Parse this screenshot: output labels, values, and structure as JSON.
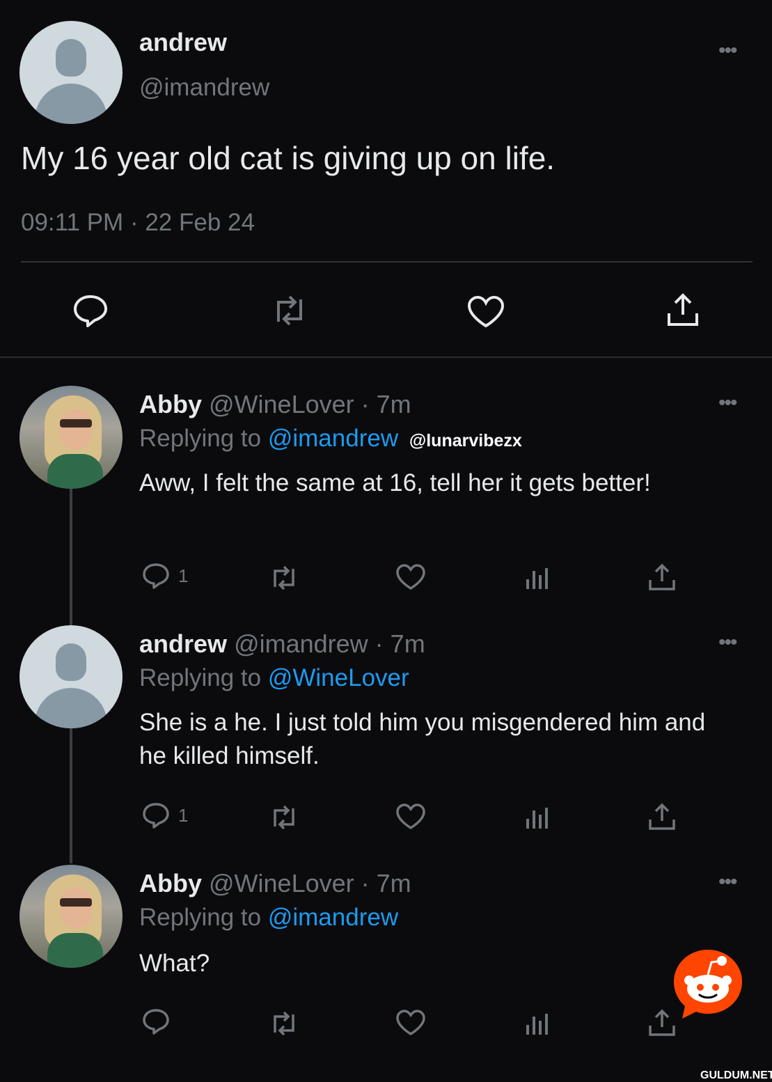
{
  "main_tweet": {
    "display_name": "andrew",
    "handle": "@imandrew",
    "text": "My 16 year old cat is giving up on life.",
    "time": "09:11 PM",
    "date": "22 Feb 24"
  },
  "replies": [
    {
      "display_name": "Abby",
      "handle": "@WineLover",
      "age": "7m",
      "replying_label": "Replying to",
      "replying_to": "@imandrew",
      "text": "Aww, I felt the same at 16, tell her it gets better!",
      "reply_count": "1"
    },
    {
      "display_name": "andrew",
      "handle": "@imandrew",
      "age": "7m",
      "replying_label": "Replying to",
      "replying_to": "@WineLover",
      "text": "She is a he. I just told him you misgendered him and he killed himself.",
      "reply_count": "1"
    },
    {
      "display_name": "Abby",
      "handle": "@WineLover",
      "age": "7m",
      "replying_label": "Replying to",
      "replying_to": "@imandrew",
      "text": "What?",
      "reply_count": ""
    }
  ],
  "overlays": {
    "watermark_handle": "@lunarvibezx",
    "site_watermark": "GULDUM.NET"
  },
  "separator": " · ",
  "icons": [
    "reply-icon",
    "retweet-icon",
    "like-icon",
    "views-icon",
    "share-icon",
    "more-icon",
    "reddit-logo-icon"
  ],
  "colors": {
    "background": "#0b0b0e",
    "text": "#e7e9ea",
    "muted": "#71767b",
    "link": "#1d9bf0",
    "reddit": "#ff4500"
  }
}
